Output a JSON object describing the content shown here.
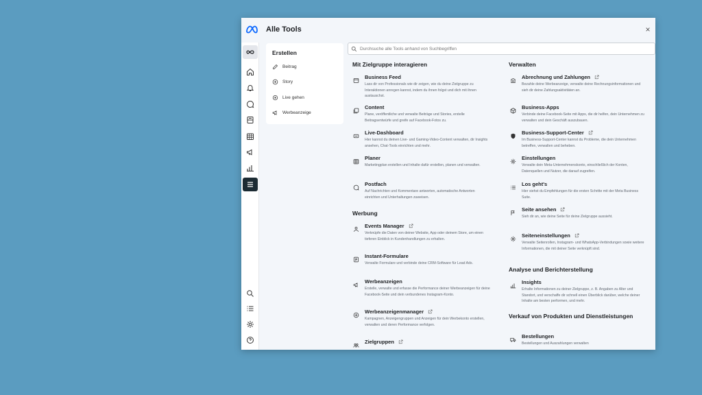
{
  "window": {
    "title": "Alle Tools",
    "close_label": "×"
  },
  "create": {
    "title": "Erstellen",
    "items": [
      {
        "label": "Beitrag",
        "icon": "edit-icon"
      },
      {
        "label": "Story",
        "icon": "story-icon"
      },
      {
        "label": "Live gehen",
        "icon": "live-icon"
      },
      {
        "label": "Werbeanzeige",
        "icon": "megaphone-icon"
      }
    ]
  },
  "search": {
    "placeholder": "Durchsuche alle Tools anhand von Suchbegriffen"
  },
  "sections": {
    "audience": "Mit Zielgruppe interagieren",
    "ads": "Werbung",
    "manage": "Verwalten",
    "analytics": "Analyse und Berichterstellung",
    "sales": "Verkauf von Produkten und Dienstleistungen"
  },
  "tools": {
    "business_feed": {
      "name": "Business Feed",
      "desc": "Lass dir von Professionals wie dir zeigen, wie du deine Zielgruppe zu Interaktionen anregen kannst, indem du ihnen folgst und dich mit ihnen austauschst."
    },
    "content": {
      "name": "Content",
      "desc": "Plane, veröffentliche und verwalte Beiträge und Stories, erstelle Beitragsentwürfe und greife auf Facebook-Fotos zu."
    },
    "live_dashboard": {
      "name": "Live-Dashboard",
      "desc": "Hier kannst du deinen Live- und Gaming-Video-Content verwalten, dir Insights ansehen, Chat-Tools einrichten und mehr."
    },
    "planer": {
      "name": "Planer",
      "desc": "Marketingplan erstellen und Inhalte dafür erstellen, planen und verwalten."
    },
    "postfach": {
      "name": "Postfach",
      "desc": "Auf Nachrichten und Kommentare antworten, automatische Antworten einrichten und Unterhaltungen zuweisen."
    },
    "events_manager": {
      "name": "Events Manager",
      "desc": "Verknüpfe die Daten von deiner Website, App oder deinem Store, um einen tieferen Einblick in Kundenhandlungen zu erhalten."
    },
    "instant_forms": {
      "name": "Instant-Formulare",
      "desc": "Verwalte Formulare und verbinde deine CRM-Software für Lead Ads."
    },
    "ads": {
      "name": "Werbeanzeigen",
      "desc": "Erstelle, verwalte und erfasse die Performance deiner Werbeanzeigen für deine Facebook-Seite und dein verbundenes Instagram-Konto."
    },
    "ads_manager": {
      "name": "Werbeanzeigenmanager",
      "desc": "Kampagnen, Anzeigengruppen und Anzeigen für dein Werbekonto erstellen, verwalten und deren Performance verfolgen."
    },
    "audiences": {
      "name": "Zielgruppen",
      "desc": ""
    },
    "billing": {
      "name": "Abrechnung und Zahlungen",
      "desc": "Bezahle deine Werbeanzeige, verwalte deine Rechnungsinformationen und sieh dir deine Zahlungsaktivitäten an."
    },
    "business_apps": {
      "name": "Business-Apps",
      "desc": "Verbinde deine Facebook-Seite mit Apps, die dir helfen, dein Unternehmen zu verwalten und dein Geschäft auszubauen."
    },
    "support": {
      "name": "Business-Support-Center",
      "desc": "Im Business-Support-Center kannst du Probleme, die dein Unternehmen betreffen, verwalten und beheben."
    },
    "settings": {
      "name": "Einstellungen",
      "desc": "Verwalte dein Meta-Unternehmenskonto, einschließlich der Konten, Datenquellen und Nutzer, die darauf zugreifen."
    },
    "lets_go": {
      "name": "Los geht's",
      "desc": "Hier siehst du Empfehlungen für die ersten Schritte mit der Meta Business Suite."
    },
    "view_page": {
      "name": "Seite ansehen",
      "desc": "Sieh dir an, wie deine Seite für deine Zielgruppe aussieht."
    },
    "page_settings": {
      "name": "Seiteneinstellungen",
      "desc": "Verwalte Seitenrollen, Instagram- und WhatsApp-Verbindungen sowie weitere Informationen, die mit deiner Seite verknüpft sind."
    },
    "insights": {
      "name": "Insights",
      "desc": "Erhalte Informationen zu deiner Zielgruppe, z. B. Angaben zu Alter und Standort, und verschaffe dir schnell einen Überblick darüber, welche deiner Inhalte am besten performen, und mehr."
    },
    "orders": {
      "name": "Bestellungen",
      "desc": "Bestellungen und Auszahlungen verwalten"
    }
  },
  "colors": {
    "background": "#5b9cc0",
    "panel": "#f3f6fa",
    "active_rail": "#1c2b33",
    "meta_blue": "#0866ff"
  }
}
